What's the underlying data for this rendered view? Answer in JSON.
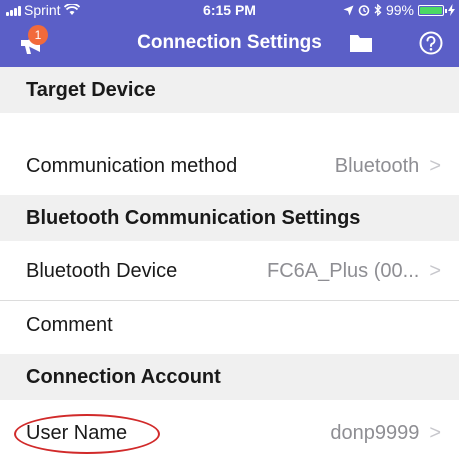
{
  "status_bar": {
    "carrier": "Sprint",
    "time": "6:15 PM",
    "battery": "99%"
  },
  "nav": {
    "title": "Connection Settings",
    "badge_count": "1"
  },
  "sections": {
    "target_device": {
      "header": "Target Device",
      "communication_method_label": "Communication method",
      "communication_method_value": "Bluetooth"
    },
    "bluetooth_settings": {
      "header": "Bluetooth Communication Settings",
      "device_label": "Bluetooth Device",
      "device_value": "FC6A_Plus (00...",
      "comment_label": "Comment"
    },
    "connection_account": {
      "header": "Connection Account",
      "user_name_label": "User Name",
      "user_name_value": "donp9999"
    }
  },
  "chevron": ">"
}
